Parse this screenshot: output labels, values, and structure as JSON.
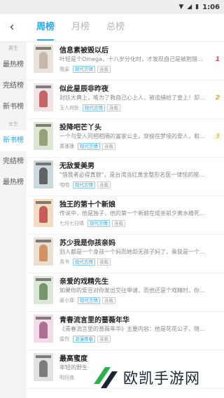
{
  "status_bar": {
    "time": "1:06"
  },
  "header": {
    "back_icon": "chevron-left-icon",
    "tabs": [
      {
        "label": "周榜",
        "active": true
      },
      {
        "label": "月榜",
        "active": false
      },
      {
        "label": "总榜",
        "active": false
      }
    ]
  },
  "sidebar": {
    "groups": [
      {
        "label": "男生",
        "items": [
          "最热榜",
          "完结榜",
          "新书榜"
        ]
      },
      {
        "label": "女生",
        "items": [
          "新书榜",
          "完结榜",
          "最热榜"
        ]
      }
    ],
    "active_label": "新书榜"
  },
  "books": [
    {
      "title": "信息素被毁以后",
      "desc": "叶轻是个Omega，十八岁分化时，才发现自己是被抱错的豪门少爷。",
      "author": "我呆",
      "tags": [
        "现代言情",
        "连载"
      ],
      "rank": "1",
      "rank_color": "#e8413c",
      "cover": [
        "#e9e3dc",
        "#b8a99a"
      ]
    },
    {
      "title": "似此星辰非昨夜",
      "desc": "封玖大典上，唯为了救自己心上人，被追捕给了皇上！却在洞房夜...",
      "author": "玉人何处",
      "tags": [
        "现代言情",
        "连载"
      ],
      "rank": "2",
      "rank_color": "#f29a2e",
      "cover": [
        "#f1e4e6",
        "#b43a3a"
      ]
    },
    {
      "title": "投降吧芒丫头",
      "desc": "一个与爱人同相相隔的富家公主，穿梭在梦境的爱人，和很实的男...",
      "author": "菁蓮蓮",
      "tags": [
        "现代言情",
        "连载"
      ],
      "rank": "3",
      "rank_color": "#f2c12e",
      "cover": [
        "#dfe6d3",
        "#7d8a5a"
      ]
    },
    {
      "title": "无敌爱美男",
      "desc": "\"惜我者必得真貌\"，是台湾当红黄金整形名医一律惊的座右铭，只...",
      "author": "咱咱",
      "tags": [
        "现代言情",
        "连载"
      ],
      "rank": "",
      "rank_color": "",
      "cover": [
        "#cdd8de",
        "#3c3c3c"
      ]
    },
    {
      "title": "独王的第十个新娘",
      "desc": "传说中，他是独子，他的第一个新娘在成亲前夕离水橹死了，第二...",
      "author": "七月七日晴",
      "tags": [
        "现代言情",
        "连载"
      ],
      "rank": "",
      "rank_color": "",
      "cover": [
        "#f3dcc4",
        "#b8323a"
      ]
    },
    {
      "title": "苏少我是你孩亲妈",
      "desc": "别人都是一个身孩一个妈而她却无孩子妈了，乘获是一个合同就把我送出去...",
      "author": "青书",
      "tags": [
        "现代言情",
        "连载"
      ],
      "rank": "",
      "rank_color": "",
      "cover": [
        "#eadfd3",
        "#c87a3c"
      ]
    },
    {
      "title": "亲爱的戏精先生",
      "desc": "如果你的爱豆对你发出交往申请，而他还是个戏精时，你是一笑而...",
      "author": "唐小菲",
      "tags": [
        "现代言情",
        "连载"
      ],
      "rank": "",
      "rank_color": "",
      "cover": [
        "#dce6d8",
        "#567a4a"
      ]
    },
    {
      "title": "青春流言里的蔷薇年华",
      "desc": "《青春流言里的蔷薇年华》主要内容：他是花花公子，随波逐流。",
      "author": "雷烈",
      "tags": [
        "浪漫青春",
        "连载"
      ],
      "rank": "",
      "rank_color": "",
      "cover": [
        "#f0dde8",
        "#9a4a7a"
      ]
    },
    {
      "title": "最高蜜度",
      "desc": "年轻的野生",
      "author": "明月夜",
      "tags": [],
      "rank": "",
      "rank_color": "",
      "cover": [
        "#e2e2e2",
        "#5a5a5a"
      ]
    }
  ],
  "watermark": {
    "text": "欧凯手游网",
    "color": "#29b34a"
  },
  "accent_color": "#29a6f2"
}
